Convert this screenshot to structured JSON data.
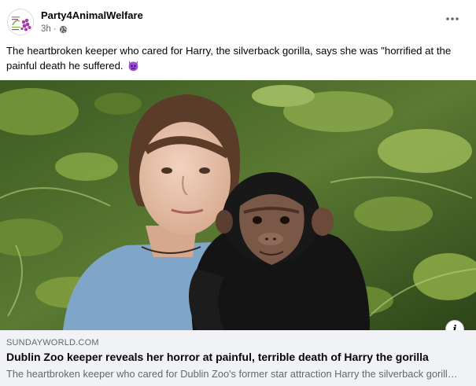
{
  "post": {
    "page_name": "Party4AnimalWelfare",
    "time_ago": "3h",
    "separator": "·",
    "privacy_icon": "globe-icon",
    "more_icon": "more-horizontal-icon",
    "caption": "The heartbroken keeper who cared for Harry, the silverback gorilla, says she was \"horrified at the painful death he suffered.",
    "caption_emoji": "angry-devil-emoji",
    "avatar_logo_text": "Party for Animal Welfare"
  },
  "link_preview": {
    "domain": "SUNDAYWORLD.COM",
    "title": "Dublin Zoo keeper reveals her horror at painful, terrible death of Harry the gorilla",
    "description": "The heartbroken keeper who cared for Dublin Zoo's former star attraction Harry the silverback gorilla says she was horrified at the painful death he suffered.",
    "info_icon": "info-icon"
  },
  "colors": {
    "text_primary": "#050505",
    "text_secondary": "#65676b",
    "card_background": "#f0f2f5",
    "logo_purple": "#a23fa8",
    "logo_green": "#7cb342"
  }
}
